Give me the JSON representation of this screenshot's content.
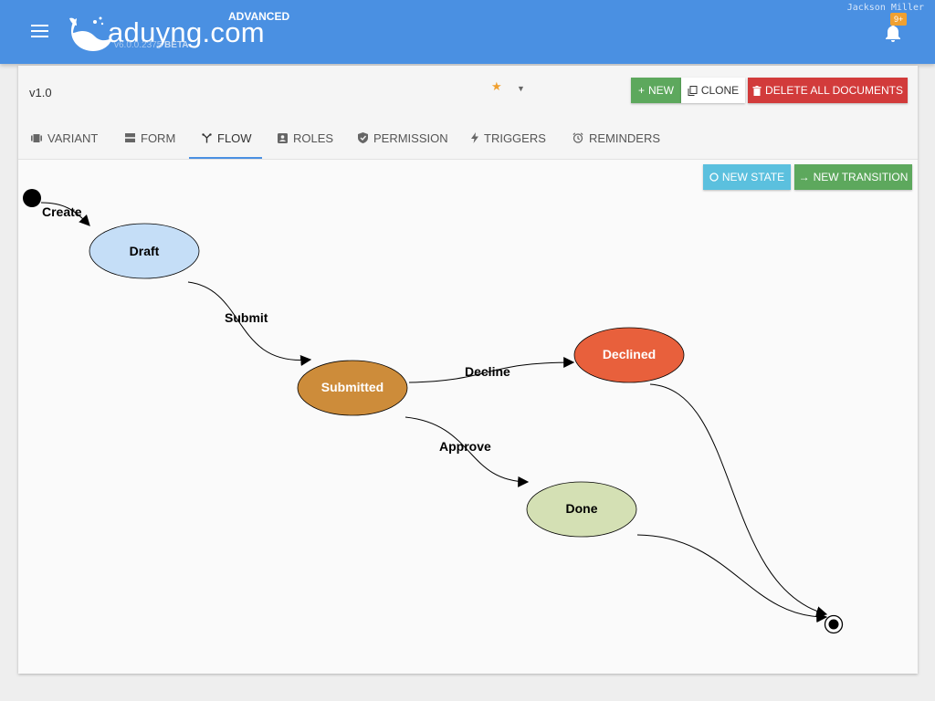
{
  "header": {
    "logo_text": "aduyng.com",
    "edition": "ADVANCED",
    "version": "v6.0.0.2375",
    "beta": "BETA",
    "username": "Jackson Miller",
    "notification_count": "9+"
  },
  "toolbar": {
    "version_label": "v1.0",
    "new_label": "NEW",
    "clone_label": "CLONE",
    "delete_label": "DELETE ALL DOCUMENTS"
  },
  "tabs": [
    {
      "label": "VARIANT",
      "icon": "variant-icon"
    },
    {
      "label": "FORM",
      "icon": "form-icon"
    },
    {
      "label": "FLOW",
      "icon": "flow-icon",
      "active": true
    },
    {
      "label": "ROLES",
      "icon": "roles-icon"
    },
    {
      "label": "PERMISSION",
      "icon": "shield-icon"
    },
    {
      "label": "TRIGGERS",
      "icon": "lightning-icon"
    },
    {
      "label": "REMINDERS",
      "icon": "alarm-icon"
    }
  ],
  "flow_actions": {
    "new_state_label": "NEW STATE",
    "new_transition_label": "NEW TRANSITION"
  },
  "flow": {
    "states": [
      {
        "name": "Draft",
        "color": "#c5def7"
      },
      {
        "name": "Submitted",
        "color": "#cd8c3a"
      },
      {
        "name": "Declined",
        "color": "#e8603c"
      },
      {
        "name": "Done",
        "color": "#d4e0b4"
      }
    ],
    "transitions": [
      {
        "label": "Create",
        "from": "start",
        "to": "Draft"
      },
      {
        "label": "Submit",
        "from": "Draft",
        "to": "Submitted"
      },
      {
        "label": "Decline",
        "from": "Submitted",
        "to": "Declined"
      },
      {
        "label": "Approve",
        "from": "Submitted",
        "to": "Done"
      },
      {
        "label": "",
        "from": "Declined",
        "to": "end"
      },
      {
        "label": "",
        "from": "Done",
        "to": "end"
      }
    ]
  },
  "colors": {
    "topbar": "#4a90e2",
    "new_button": "#5da85d",
    "delete_button": "#d23b3b",
    "new_state_button": "#5bc0de",
    "badge": "#f0a030"
  }
}
